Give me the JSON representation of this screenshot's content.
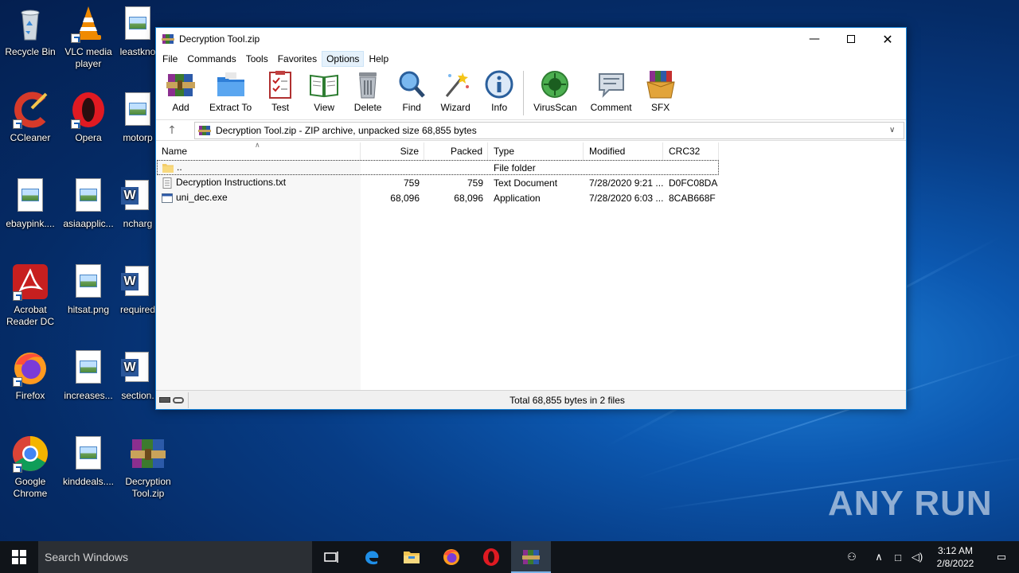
{
  "desktop": {
    "icons": [
      {
        "label": "Recycle Bin"
      },
      {
        "label": "VLC media player"
      },
      {
        "label": "leastkno"
      },
      {
        "label": "CCleaner"
      },
      {
        "label": "Opera"
      },
      {
        "label": "motorp"
      },
      {
        "label": "ebaypink...."
      },
      {
        "label": "asiaapplic..."
      },
      {
        "label": "ncharg"
      },
      {
        "label": "Acrobat Reader DC"
      },
      {
        "label": "hitsat.png"
      },
      {
        "label": "required"
      },
      {
        "label": "Firefox"
      },
      {
        "label": "increases..."
      },
      {
        "label": "section."
      },
      {
        "label": "Google Chrome"
      },
      {
        "label": "kinddeals...."
      },
      {
        "label": "Decryption Tool.zip"
      }
    ],
    "watermark": "ANY RUN"
  },
  "window": {
    "title": "Decryption Tool.zip",
    "menu": [
      "File",
      "Commands",
      "Tools",
      "Favorites",
      "Options",
      "Help"
    ],
    "toolbar": [
      {
        "label": "Add",
        "icon": "add-archive-icon"
      },
      {
        "label": "Extract To",
        "icon": "extract-folder-icon"
      },
      {
        "label": "Test",
        "icon": "test-clipboard-icon"
      },
      {
        "label": "View",
        "icon": "view-book-icon"
      },
      {
        "label": "Delete",
        "icon": "trash-icon"
      },
      {
        "label": "Find",
        "icon": "magnifier-icon"
      },
      {
        "label": "Wizard",
        "icon": "magic-wand-icon"
      },
      {
        "label": "Info",
        "icon": "info-icon"
      },
      {
        "label": "VirusScan",
        "icon": "virus-scan-icon"
      },
      {
        "label": "Comment",
        "icon": "comment-icon"
      },
      {
        "label": "SFX",
        "icon": "sfx-box-icon"
      }
    ],
    "address": "Decryption Tool.zip - ZIP archive, unpacked size 68,855 bytes",
    "columns": [
      "Name",
      "Size",
      "Packed",
      "Type",
      "Modified",
      "CRC32"
    ],
    "files": [
      {
        "name": "..",
        "size": "",
        "packed": "",
        "type": "File folder",
        "modified": "",
        "crc": "",
        "icon": "folder-icon"
      },
      {
        "name": "Decryption Instructions.txt",
        "size": "759",
        "packed": "759",
        "type": "Text Document",
        "modified": "7/28/2020 9:21 ...",
        "crc": "D0FC08DA",
        "icon": "text-file-icon"
      },
      {
        "name": "uni_dec.exe",
        "size": "68,096",
        "packed": "68,096",
        "type": "Application",
        "modified": "7/28/2020 6:03 ...",
        "crc": "8CAB668F",
        "icon": "exe-file-icon"
      }
    ],
    "status": "Total 68,855 bytes in 2 files"
  },
  "taskbar": {
    "search_placeholder": "Search Windows",
    "time": "3:12 AM",
    "date": "2/8/2022"
  }
}
